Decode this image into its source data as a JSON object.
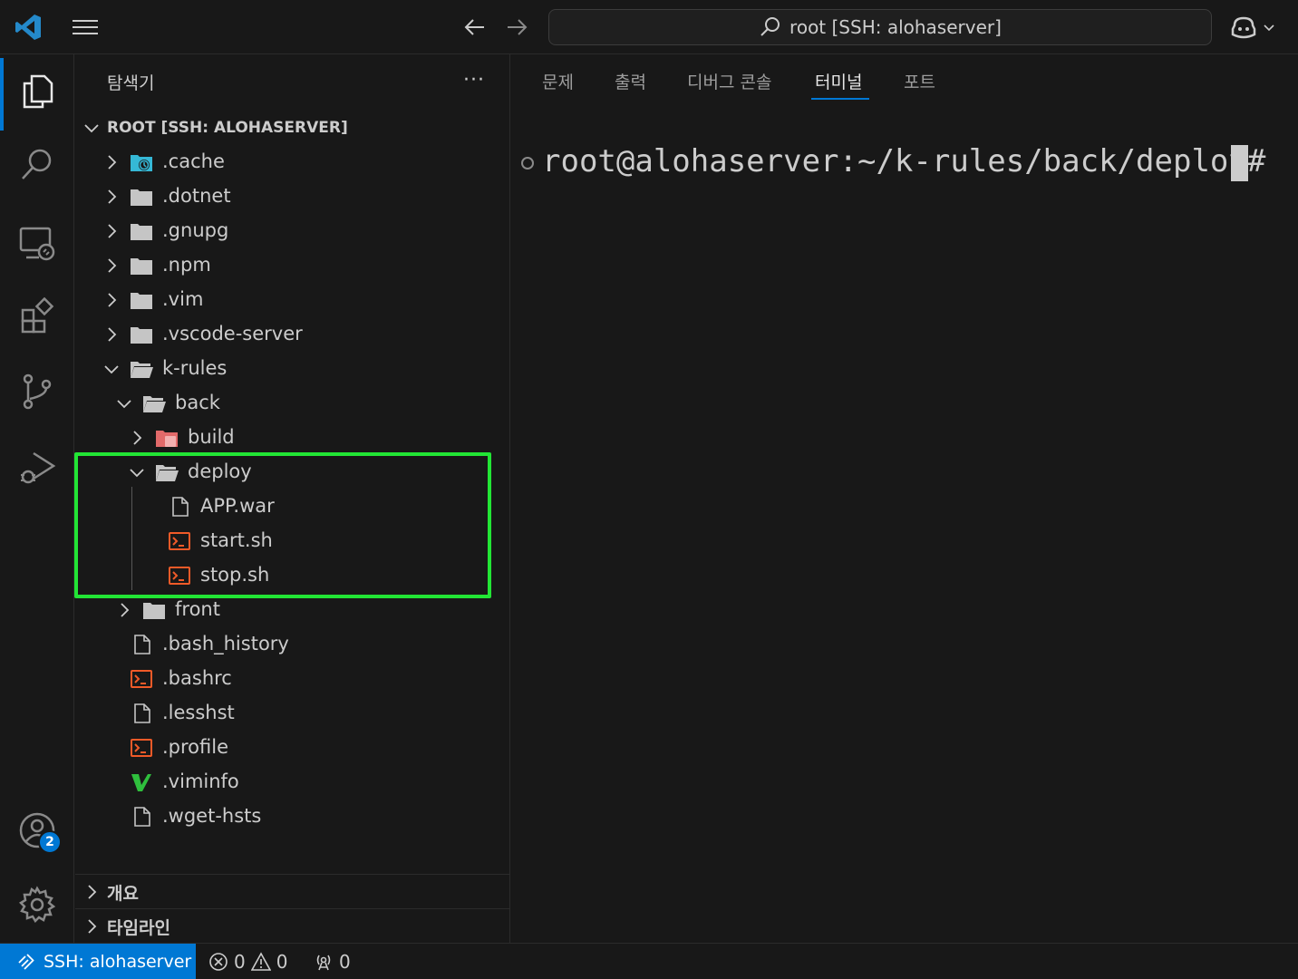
{
  "titlebar": {
    "command_center": "root [SSH: alohaserver]"
  },
  "sidebar": {
    "title": "탐색기",
    "more": "···",
    "root_label": "ROOT [SSH: ALOHASERVER]",
    "tree": [
      {
        "name": ".cache",
        "type": "folder-special",
        "expanded": false
      },
      {
        "name": ".dotnet",
        "type": "folder",
        "expanded": false
      },
      {
        "name": ".gnupg",
        "type": "folder",
        "expanded": false
      },
      {
        "name": ".npm",
        "type": "folder",
        "expanded": false
      },
      {
        "name": ".vim",
        "type": "folder",
        "expanded": false
      },
      {
        "name": ".vscode-server",
        "type": "folder",
        "expanded": false
      },
      {
        "name": "k-rules",
        "type": "folder",
        "expanded": true
      },
      {
        "name": "back",
        "type": "folder",
        "expanded": true
      },
      {
        "name": "build",
        "type": "folder-build",
        "expanded": false
      },
      {
        "name": "deploy",
        "type": "folder",
        "expanded": true
      },
      {
        "name": "APP.war",
        "type": "file"
      },
      {
        "name": "start.sh",
        "type": "shell"
      },
      {
        "name": "stop.sh",
        "type": "shell"
      },
      {
        "name": "front",
        "type": "folder",
        "expanded": false
      },
      {
        "name": ".bash_history",
        "type": "file"
      },
      {
        "name": ".bashrc",
        "type": "shell"
      },
      {
        "name": ".lesshst",
        "type": "file"
      },
      {
        "name": ".profile",
        "type": "shell"
      },
      {
        "name": ".viminfo",
        "type": "vim"
      },
      {
        "name": ".wget-hsts",
        "type": "file"
      }
    ],
    "sections": [
      "개요",
      "타임라인"
    ]
  },
  "activity": {
    "accounts_badge": "2"
  },
  "panel": {
    "tabs": [
      "문제",
      "출력",
      "디버그 콘솔",
      "터미널",
      "포트"
    ],
    "active_tab": "터미널",
    "terminal_prompt": "root@alohaserver:~/k-rules/back/deploy#"
  },
  "statusbar": {
    "remote": "SSH: alohaserver",
    "errors": "0",
    "warnings": "0",
    "ports": "0"
  },
  "colors": {
    "accent": "#0078d4",
    "highlight_box": "#22e535",
    "shell_icon": "#f05a28",
    "vim_icon": "#2fbf3d",
    "cache_icon": "#35b8d6"
  }
}
